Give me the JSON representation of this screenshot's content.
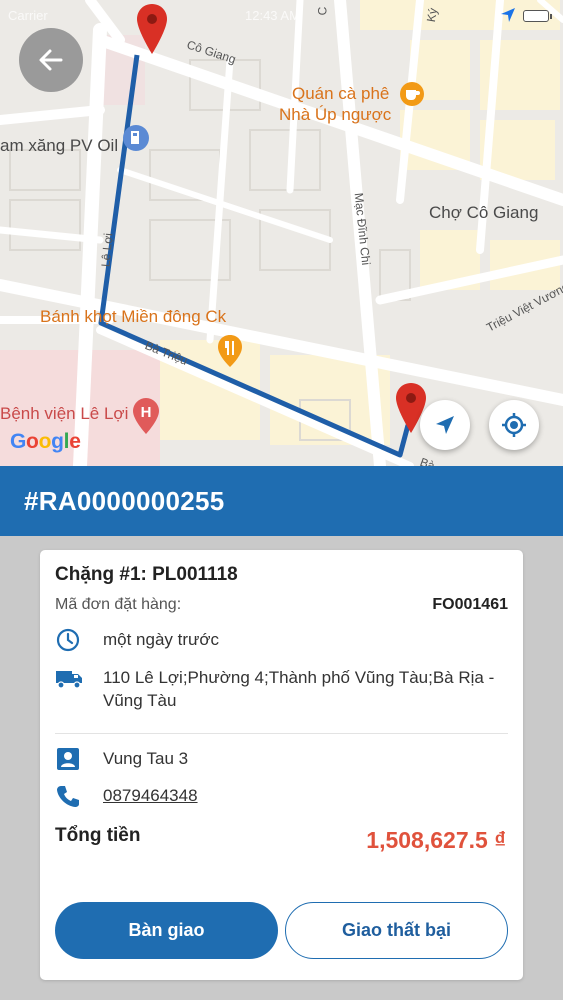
{
  "status_bar": {
    "carrier": "Carrier",
    "time": "12:43 AM"
  },
  "map": {
    "labels": {
      "street_co_giang": "Cô Giang",
      "street_ky": "Ký",
      "street_c": "C",
      "street_le_loi": "Lê Lợi",
      "street_mac_dinh_chi": "Mạc Đĩnh Chi",
      "street_ba_trieu": "Bà Triệu",
      "street_trieu_viet_vuong": "Triệu Việt Vương",
      "street_ba": "Bà",
      "cafe": "Quán cà phê",
      "cafe_line2": "Nhà Úp ngược",
      "gas_station": "am xăng PV Oil",
      "market": "Chợ Cô Giang",
      "restaurant": "Bánh khọt Miền đông Ck",
      "hospital": "Bệnh viện Lê Lợi"
    },
    "google_letters": [
      "G",
      "o",
      "o",
      "g",
      "l",
      "e"
    ],
    "route_color": "#1f5ea8",
    "pin_color": "#d93025"
  },
  "order": {
    "code": "#RA0000000255"
  },
  "card": {
    "stage_title": "Chặng #1: PL001118",
    "order_label": "Mã đơn đặt hàng:",
    "order_value": "FO001461",
    "time": "một ngày trước",
    "address": "110 Lê Lợi;Phường 4;Thành phố Vũng Tàu;Bà Rịa - Vũng Tàu",
    "contact_name": "Vung Tau 3",
    "phone": "0879464348",
    "total_label": "Tổng tiền",
    "total_value": "1,508,627.5 ₫"
  },
  "buttons": {
    "handover": "Bàn giao",
    "failed": "Giao thất bại"
  },
  "colors": {
    "primary": "#1f6db1",
    "accent_red": "#e0523c"
  }
}
